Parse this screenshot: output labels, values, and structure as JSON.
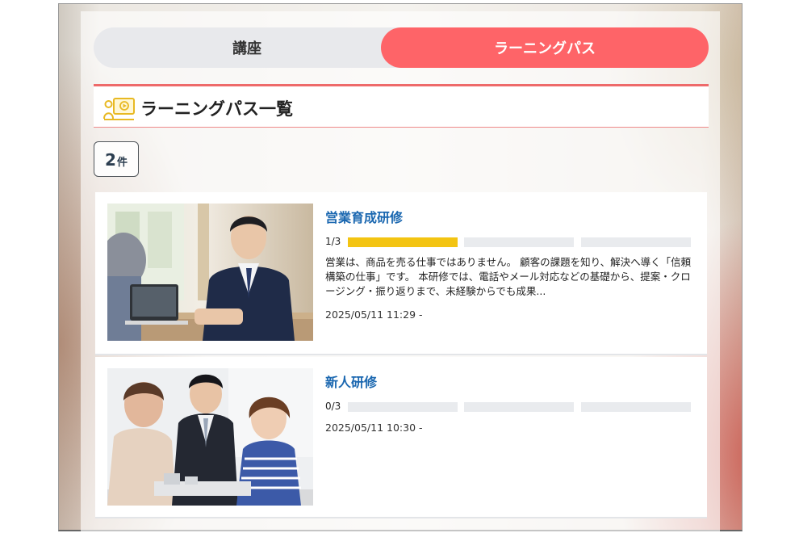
{
  "tabs": {
    "courses_label": "講座",
    "learning_path_label": "ラーニングパス"
  },
  "section": {
    "title": "ラーニングパス一覧",
    "icon": "presentation-icon"
  },
  "count": {
    "number": "2",
    "unit": "件"
  },
  "colors": {
    "accent": "#fe6468",
    "title_link": "#1a67b0",
    "progress_done": "#f3c412",
    "progress_empty": "#e9ebee"
  },
  "paths": [
    {
      "title": "営業育成研修",
      "progress_label": "1/3",
      "progress_done": 1,
      "progress_total": 3,
      "description": "営業は、商品を売る仕事ではありません。 顧客の課題を知り、解決へ導く「信頼構築の仕事」です。 本研修では、電話やメール対応などの基礎から、提案・クロージング・振り返りまで、未経験からでも成果...",
      "date": "2025/05/11 11:29 -"
    },
    {
      "title": "新人研修",
      "progress_label": "0/3",
      "progress_done": 0,
      "progress_total": 3,
      "description": "",
      "date": "2025/05/11 10:30 -"
    }
  ]
}
